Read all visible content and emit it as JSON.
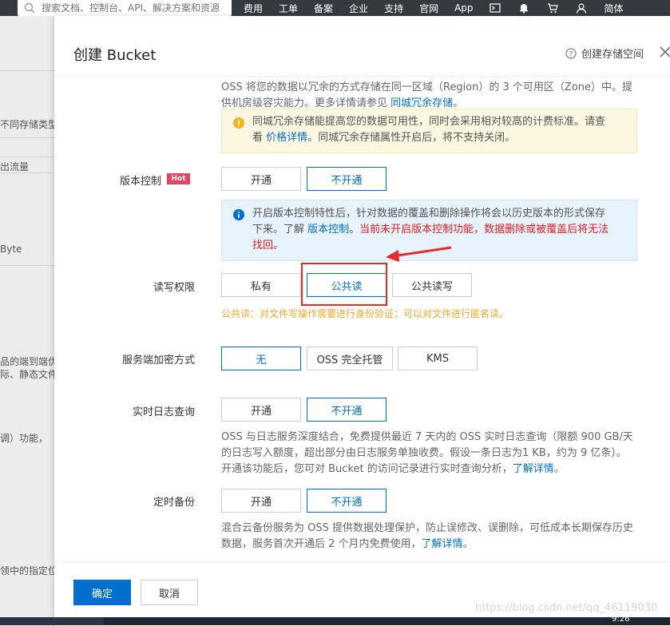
{
  "topbar": {
    "search_placeholder": "搜索文档、控制台、API、解决方案和资源",
    "nav": [
      "费用",
      "工单",
      "备案",
      "企业",
      "支持",
      "官网",
      "App"
    ],
    "lang": "简体"
  },
  "background_page": {
    "texts": [
      "不同存储类型",
      "出流量",
      "Byte",
      "品的端到端优",
      "际、静态文件",
      "调）功能，",
      "领中的指定位"
    ]
  },
  "drawer": {
    "title": "创建 Bucket",
    "help_link": "创建存储空间",
    "redundancy": {
      "line1": "OSS 将您的数据以冗余的方式存储在同一区域（Region）的 3 个可用区（Zone）中。提",
      "line2_prefix": "供机房级容灾能力。更多详情请参见 ",
      "line2_link": "同城冗余存储",
      "line2_suffix": "。"
    },
    "warning": {
      "line1": "同城冗余存储能提高您的数据可用性，同时会采用相对较高的计费标准。请查",
      "line2_prefix": "看 ",
      "line2_link": "价格详情",
      "line2_suffix": "。同城冗余存储属性开启后，将不支持关闭。"
    },
    "versioning": {
      "label": "版本控制",
      "badge": "Hot",
      "options": [
        "开通",
        "不开通"
      ],
      "selected": "不开通",
      "info_line1": "开启版本控制特性后，针对数据的覆盖和删除操作将会以历史版本的形式保存",
      "info_line2_prefix": "下来。了解 ",
      "info_line2_link": "版本控制",
      "info_line2_sep": "。",
      "info_line2_danger": "当前未开启版本控制功能，数据删除或被覆盖后将无法",
      "info_line3_danger": "找回。"
    },
    "acl": {
      "label": "读写权限",
      "options": [
        "私有",
        "公共读",
        "公共读写"
      ],
      "selected": "公共读",
      "hint": "公共读：对文件写操作需要进行身份验证；可以对文件进行匿名读。"
    },
    "encryption": {
      "label": "服务端加密方式",
      "options": [
        "无",
        "OSS 完全托管",
        "KMS"
      ],
      "selected": "无"
    },
    "realtime_log": {
      "label": "实时日志查询",
      "options": [
        "开通",
        "不开通"
      ],
      "selected": "不开通",
      "desc_line1": "OSS 与日志服务深度结合，免费提供最近 7 天内的 OSS 实时日志查询（限额 900 GB/天",
      "desc_line2": "的日志写入额度，超出部分由日志服务单独收费。假设一条日志为1 KB，约为 9 亿条）。",
      "desc_line3_prefix": "开通该功能后，您可对 Bucket 的访问记录进行实时查询分析，",
      "desc_line3_link": "了解详情",
      "desc_line3_suffix": "。"
    },
    "backup": {
      "label": "定时备份",
      "options": [
        "开通",
        "不开通"
      ],
      "selected": "不开通",
      "desc_line1": "混合云备份服务为 OSS 提供数据处理保护，防止误修改、误删除，可低成本长期保存历史",
      "desc_line2_prefix": "数据，服务首次开通后 2 个月内免费使用，",
      "desc_line2_link": "了解详情",
      "desc_line2_suffix": "。"
    },
    "footer": {
      "confirm": "确定",
      "cancel": "取消"
    },
    "watermark": "https://blog.csdn.net/qq_46119030"
  },
  "taskbar": {
    "clock": "9:26"
  },
  "colors": {
    "primary": "#0070cc",
    "danger": "#e02020",
    "warning": "#f0a928",
    "hot": "#e54560",
    "annotation": "#e82a2a"
  }
}
